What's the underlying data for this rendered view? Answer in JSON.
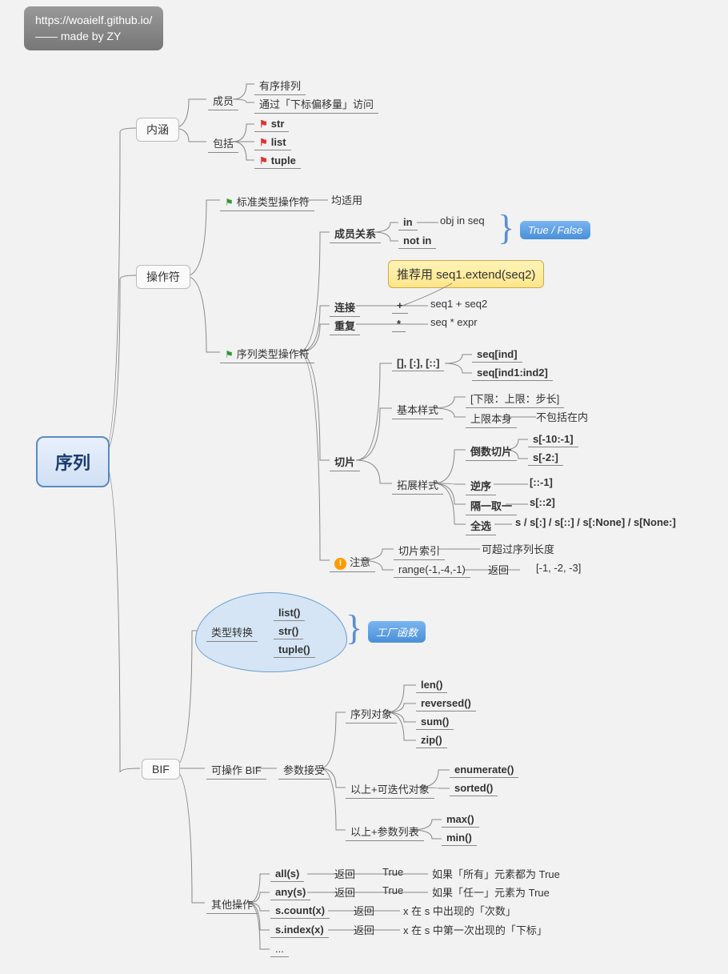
{
  "watermark": {
    "url": "https://woaielf.github.io/",
    "author": "—— made by ZY"
  },
  "root": "序列",
  "b1": {
    "title": "内涵",
    "c1": "成员",
    "c1a": "有序排列",
    "c1b": "通过「下标偏移量」访问",
    "c2": "包括",
    "c2a": "str",
    "c2b": "list",
    "c2c": "tuple"
  },
  "b2": {
    "title": "操作符",
    "a": "标准类型操作符",
    "a1": "均适用",
    "b": "序列类型操作符",
    "m": "成员关系",
    "m1": "in",
    "m1d": "obj in seq",
    "m2": "not in",
    "mr": "True / False",
    "tip": "推荐用 seq1.extend(seq2)",
    "lj": "连接",
    "lj1": "+",
    "lj2": "seq1 + seq2",
    "cf": "重复",
    "cf1": "*",
    "cf2": "seq * expr",
    "qp": "切片",
    "qp1": "[], [:], [::]",
    "qp1a": "seq[ind]",
    "qp1b": "seq[ind1:ind2]",
    "jb": "基本样式",
    "jb1": "[下限：上限：步长]",
    "jb2": "上限本身",
    "jb2d": "不包括在内",
    "tz": "拓展样式",
    "ds": "倒数切片",
    "ds1": "s[-10:-1]",
    "ds2": "s[-2:]",
    "nx": "逆序",
    "nx1": "[::-1]",
    "gy": "隔一取一",
    "gy1": "s[::2]",
    "qx": "全选",
    "qx1": "s / s[:] / s[::] / s[:None] / s[None:]",
    "zy": "注意",
    "zy1": "切片索引",
    "zy1d": "可超过序列长度",
    "zy2": "range(-1,-4,-1)",
    "zy2a": "返回",
    "zy2b": "[-1, -2, -3]"
  },
  "b3": {
    "title": "BIF",
    "zh": "类型转换",
    "zh1": "list()",
    "zh2": "str()",
    "zh3": "tuple()",
    "zhb": "工厂函数",
    "kb": "可操作 BIF",
    "cs": "参数接受",
    "xd": "序列对象",
    "xd1": "len()",
    "xd2": "reversed()",
    "xd3": "sum()",
    "xd4": "zip()",
    "kd": "以上+可迭代对象",
    "kd1": "enumerate()",
    "kd2": "sorted()",
    "cl": "以上+参数列表",
    "cl1": "max()",
    "cl2": "min()",
    "qt": "其他操作",
    "all": "all(s)",
    "all_r": "返回",
    "all_t": "True",
    "all_d": "如果「所有」元素都为 True",
    "any": "any(s)",
    "any_d": "如果「任一」元素为 True",
    "cnt": "s.count(x)",
    "cnt_d": "x 在 s 中出现的「次数」",
    "idx": "s.index(x)",
    "idx_d": "x 在 s 中第一次出现的「下标」",
    "more": "..."
  }
}
